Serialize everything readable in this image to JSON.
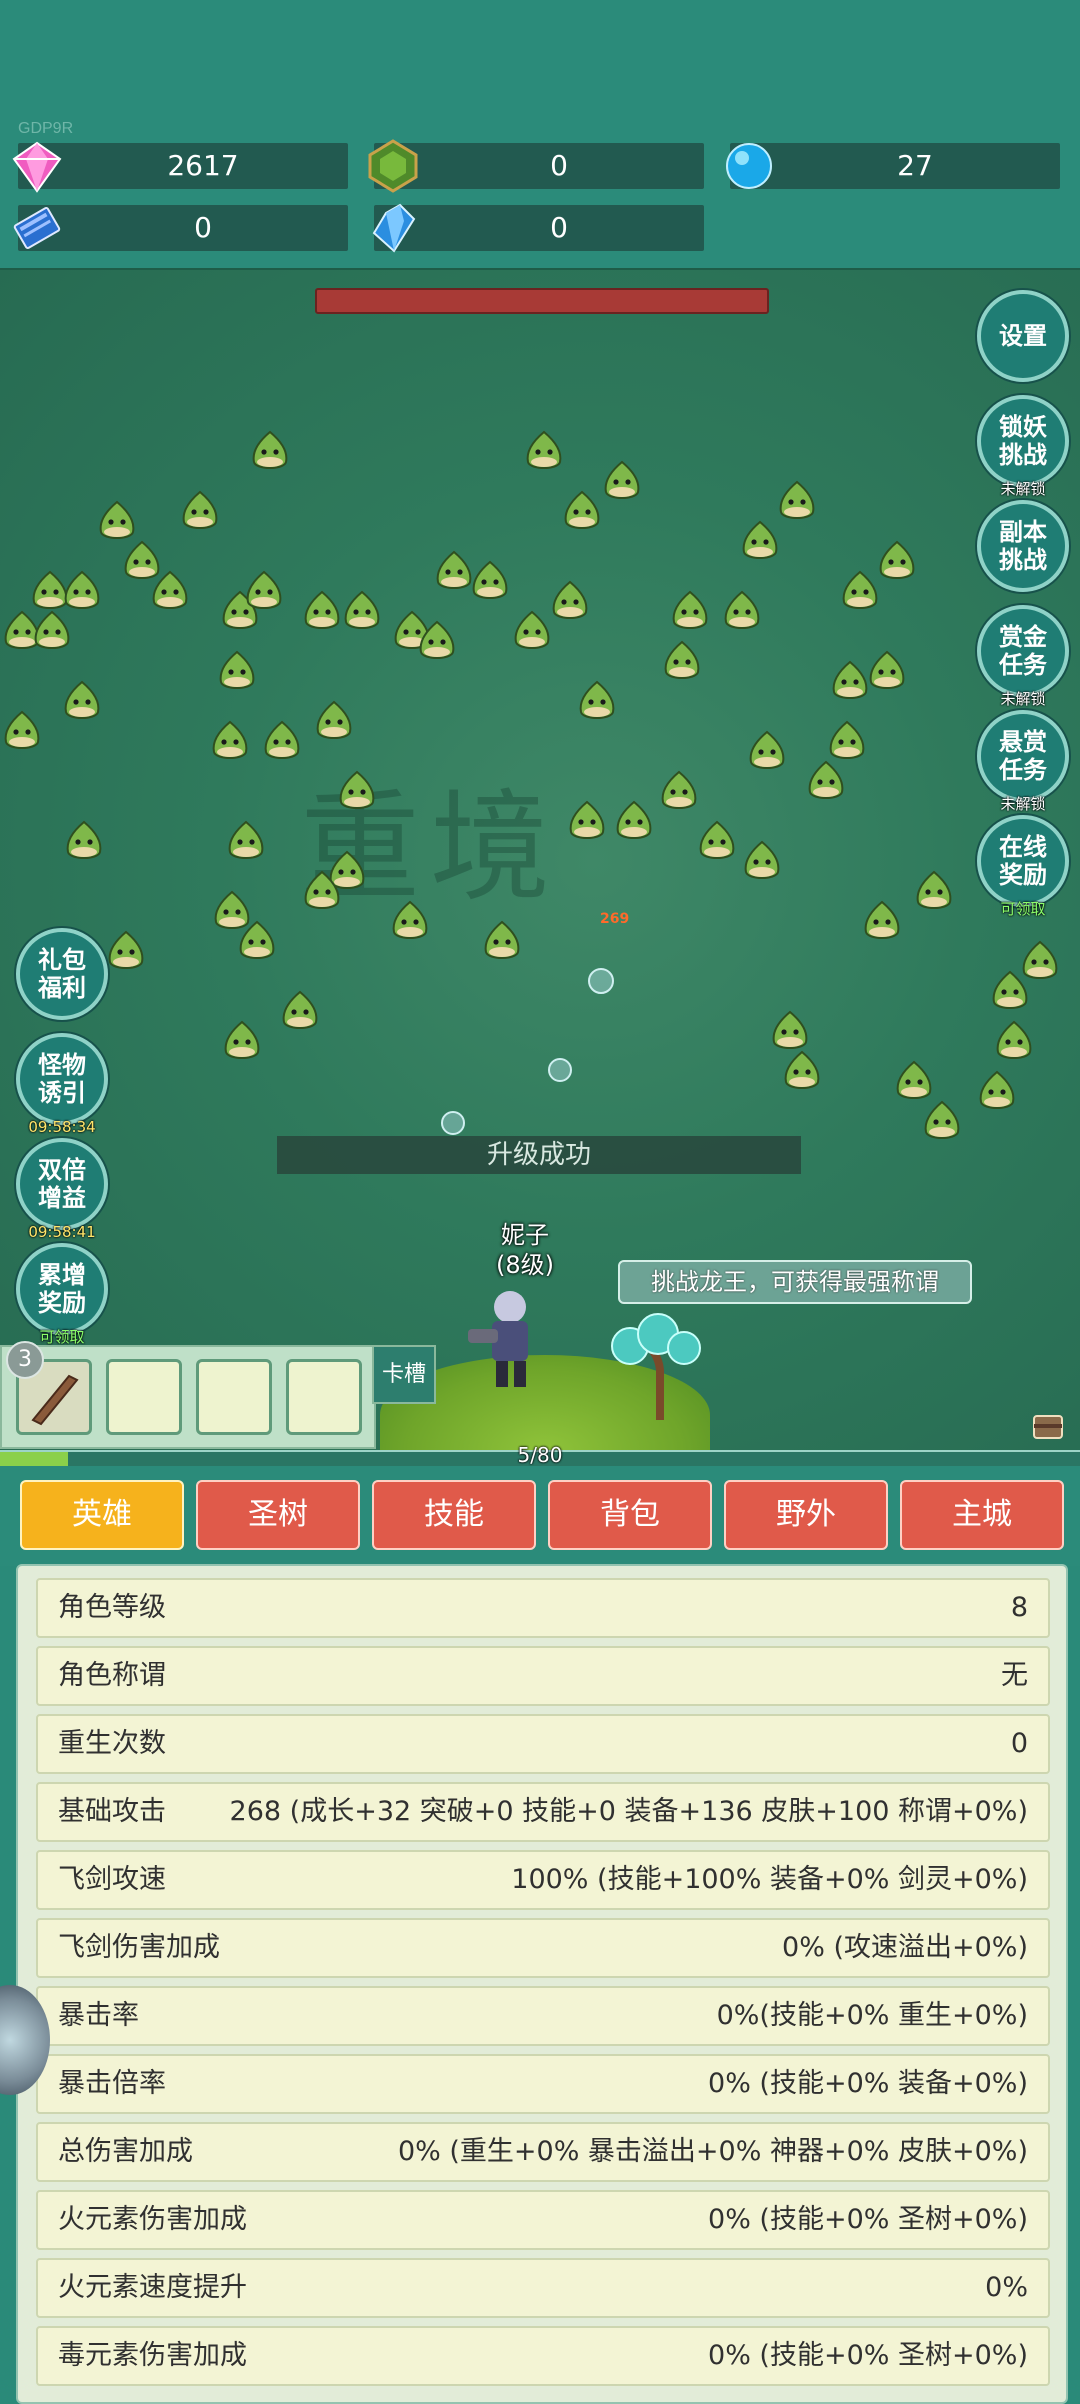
{
  "top": {
    "gdp_label": "GDP9R",
    "resources": [
      {
        "icon": "pink-gem-icon",
        "value": "2617"
      },
      {
        "icon": "green-gem-icon",
        "value": "0"
      },
      {
        "icon": "blue-orb-icon",
        "value": "27"
      },
      {
        "icon": "book-icon",
        "value": "0"
      },
      {
        "icon": "blue-crystal-icon",
        "value": "0"
      }
    ]
  },
  "battle": {
    "boss_hp_percent": 100,
    "damage_popup": "269",
    "toast": "升级成功",
    "hero_name": "妮子",
    "hero_level": "(8级)",
    "tip": "挑战龙王，可获得最强称谓",
    "watermark": "重境"
  },
  "right_buttons": [
    {
      "label": "设置",
      "sub": ""
    },
    {
      "label": "锁妖挑战",
      "sub": "未解锁"
    },
    {
      "label": "副本挑战",
      "sub": ""
    },
    {
      "label": "赏金任务",
      "sub": "未解锁"
    },
    {
      "label": "悬赏任务",
      "sub": "未解锁"
    },
    {
      "label": "在线奖励",
      "sub": "可领取"
    }
  ],
  "left_buttons": [
    {
      "label": "礼包福利",
      "sub": ""
    },
    {
      "label": "怪物诱引",
      "sub": "09:58:34"
    },
    {
      "label": "双倍增益",
      "sub": "09:58:41"
    },
    {
      "label": "累增奖励",
      "sub": "可领取"
    }
  ],
  "skill_slots": {
    "level": "3",
    "card_slot_label": "卡槽"
  },
  "xp": {
    "current": 5,
    "max": 80,
    "text": "5/80"
  },
  "tabs": [
    "英雄",
    "圣树",
    "技能",
    "背包",
    "野外",
    "主城"
  ],
  "stats": [
    {
      "name": "角色等级",
      "value": "8"
    },
    {
      "name": "角色称谓",
      "value": "无"
    },
    {
      "name": "重生次数",
      "value": "0"
    },
    {
      "name": "基础攻击",
      "value": "268 (成长+32 突破+0 技能+0 装备+136 皮肤+100 称谓+0%)"
    },
    {
      "name": "飞剑攻速",
      "value": "100% (技能+100% 装备+0% 剑灵+0%)"
    },
    {
      "name": "飞剑伤害加成",
      "value": "0% (攻速溢出+0%)"
    },
    {
      "name": "暴击率",
      "value": "0%(技能+0% 重生+0%)"
    },
    {
      "name": "暴击倍率",
      "value": "0% (技能+0% 装备+0%)"
    },
    {
      "name": "总伤害加成",
      "value": "0% (重生+0% 暴击溢出+0% 神器+0% 皮肤+0%)"
    },
    {
      "name": "火元素伤害加成",
      "value": "0% (技能+0% 圣树+0%)"
    },
    {
      "name": "火元素速度提升",
      "value": "0%"
    },
    {
      "name": "毒元素伤害加成",
      "value": "0% (技能+0% 圣树+0%)"
    }
  ],
  "colors": {
    "background": "#2b8b7a",
    "tab_red": "#e05a4a",
    "tab_active": "#f6b21c",
    "row_bg": "#f3f4d4"
  }
}
